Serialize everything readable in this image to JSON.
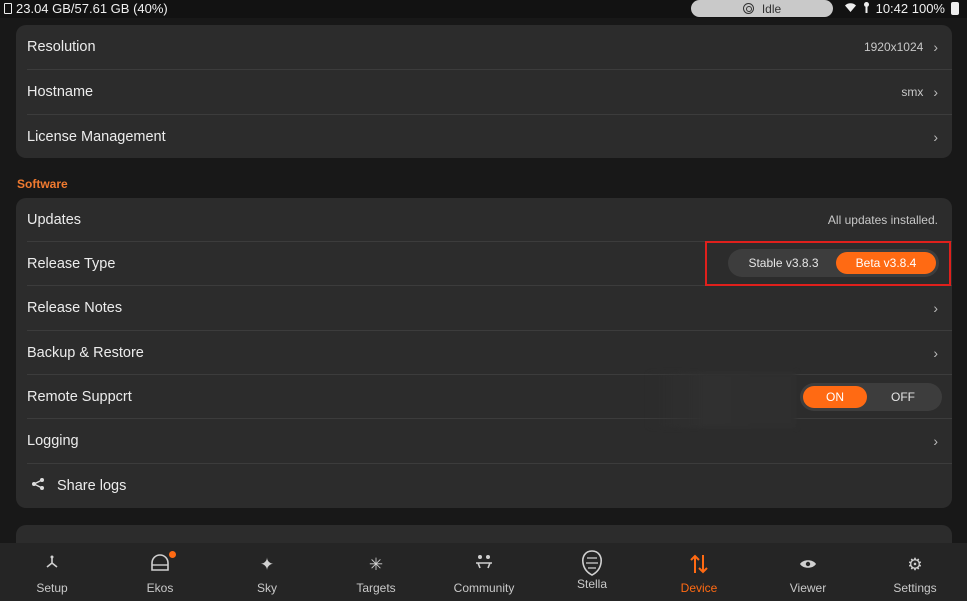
{
  "status_bar": {
    "storage": "23.04 GB/57.61 GB (40%)",
    "idle": "Idle",
    "time_battery": "10:42 100%"
  },
  "device_panel": {
    "rows": [
      {
        "label": "Resolution",
        "value": "1920x1024"
      },
      {
        "label": "Hostname",
        "value": "smx"
      },
      {
        "label": "License Management",
        "value": ""
      }
    ]
  },
  "software": {
    "section_title": "Software",
    "updates": {
      "label": "Updates",
      "value": "All updates installed."
    },
    "release_type": {
      "label": "Release Type",
      "stable": "Stable v3.8.3",
      "beta": "Beta v3.8.4",
      "selected": "beta"
    },
    "release_notes": {
      "label": "Release Notes"
    },
    "backup_restore": {
      "label": "Backup & Restore"
    },
    "remote_support": {
      "label": "Remote Suppcrt",
      "on": "ON",
      "off": "OFF",
      "selected": "on"
    },
    "logging": {
      "label": "Logging"
    },
    "share_logs": {
      "label": "Share logs"
    }
  },
  "nav": {
    "items": [
      {
        "label": "Setup",
        "icon": "setup-icon"
      },
      {
        "label": "Ekos",
        "icon": "ekos-icon",
        "badge": true
      },
      {
        "label": "Sky",
        "icon": "sky-icon"
      },
      {
        "label": "Targets",
        "icon": "targets-icon"
      },
      {
        "label": "Community",
        "icon": "community-icon"
      },
      {
        "label": "Stella",
        "icon": "stella-icon"
      },
      {
        "label": "Device",
        "icon": "device-icon",
        "active": true
      },
      {
        "label": "Viewer",
        "icon": "viewer-icon"
      },
      {
        "label": "Settings",
        "icon": "settings-icon"
      }
    ]
  },
  "colors": {
    "accent": "#ff6a13",
    "highlight": "#e0201c",
    "panel": "#2c2c2c"
  }
}
